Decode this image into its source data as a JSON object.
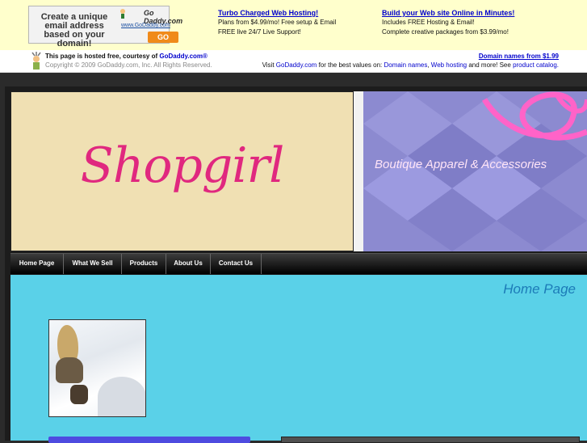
{
  "ad": {
    "text": "Create a unique email address based on your domain!",
    "logo": "Go Daddy.com",
    "url": "www.GoDaddy.com",
    "go": "GO"
  },
  "promos": [
    {
      "title": "Turbo Charged Web Hosting!",
      "line1": "Plans from $4.99/mo! Free setup & Email",
      "line2": "FREE live 24/7 Live Support!"
    },
    {
      "title": "Build your Web site Online in Minutes!",
      "line1": "Includes FREE Hosting & Email!",
      "line2": "Complete creative packages from $3.99/mo!"
    }
  ],
  "hosted": {
    "text": "This page is hosted free, courtesy of",
    "link": "GoDaddy.com®",
    "copyright": "Copyright © 2009 GoDaddy.com, Inc. All Rights Reserved.",
    "domains_link": "Domain names from $1.99",
    "visit": "Visit",
    "visit_link": "GoDaddy.com",
    "for_values": "for the best values on:",
    "link_domain_names": "Domain names",
    "link_web_hosting": "Web hosting",
    "and_more": "and more! See",
    "link_catalog": "product catalog."
  },
  "site": {
    "logo": "Shopgirl",
    "tagline": "Boutique Apparel & Accessories"
  },
  "nav": [
    "Home Page",
    "What We Sell",
    "Products",
    "About Us",
    "Contact Us"
  ],
  "page": {
    "heading": "Home Page"
  },
  "colors": {
    "accent": "#e0287f",
    "content_bg": "#5ad1e8",
    "heading": "#1c7bb8"
  }
}
